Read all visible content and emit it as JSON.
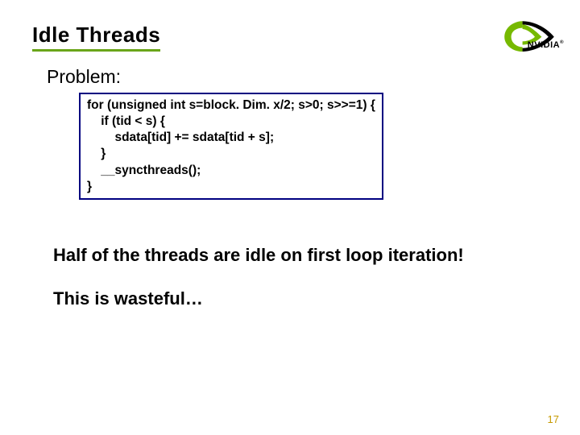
{
  "title": "Idle Threads",
  "problem_label": "Problem:",
  "code": "for (unsigned int s=block. Dim. x/2; s>0; s>>=1) {\n    if (tid < s) {\n        sdata[tid] += sdata[tid + s];\n    }\n    __syncthreads();\n}",
  "line1": "Half of the threads are idle on first loop iteration!",
  "line2": "This is wasteful…",
  "logo_text": "NVIDIA",
  "pagenum": "17"
}
